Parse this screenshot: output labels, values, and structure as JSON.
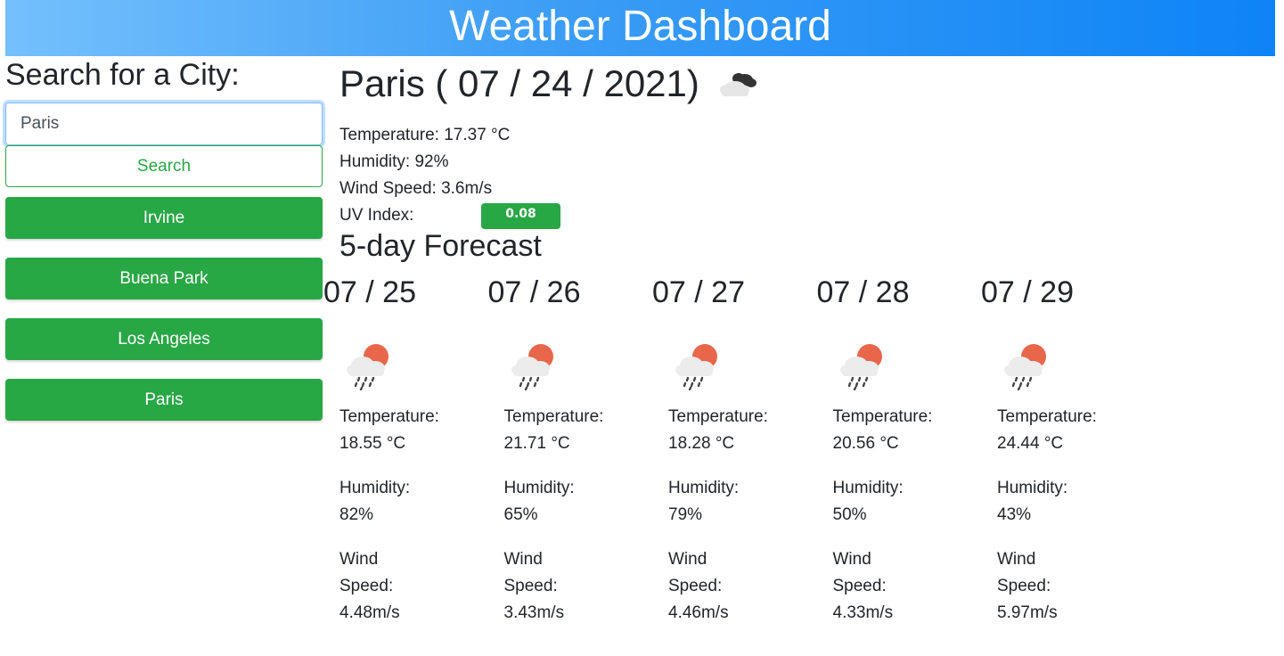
{
  "header": {
    "title": "Weather Dashboard"
  },
  "sidebar": {
    "heading": "Search for a City:",
    "search_value": "Paris",
    "search_button": "Search",
    "cities": [
      "Irvine",
      "Buena Park",
      "Los Angeles",
      "Paris"
    ]
  },
  "current": {
    "title": "Paris ( 07 / 24 / 2021)",
    "icon": "cloudy-icon",
    "temperature": "Temperature: 17.37 °C",
    "humidity": "Humidity: 92%",
    "wind": "Wind Speed: 3.6m/s",
    "uv_label": "UV Index:",
    "uv_value": "0.08",
    "uv_color": "#28a745"
  },
  "forecast": {
    "title": "5-day Forecast",
    "icon": "rain-sun-icon",
    "days": [
      {
        "date": "07 / 25",
        "temp_label": "Temperature:",
        "temp": "18.55 °C",
        "hum_label": "Humidity:",
        "hum": "82%",
        "wind_label1": "Wind",
        "wind_label2": "Speed:",
        "wind": "4.48m/s"
      },
      {
        "date": "07 / 26",
        "temp_label": "Temperature:",
        "temp": "21.71 °C",
        "hum_label": "Humidity:",
        "hum": "65%",
        "wind_label1": "Wind",
        "wind_label2": "Speed:",
        "wind": "3.43m/s"
      },
      {
        "date": "07 / 27",
        "temp_label": "Temperature:",
        "temp": "18.28 °C",
        "hum_label": "Humidity:",
        "hum": "79%",
        "wind_label1": "Wind",
        "wind_label2": "Speed:",
        "wind": "4.46m/s"
      },
      {
        "date": "07 / 28",
        "temp_label": "Temperature:",
        "temp": "20.56 °C",
        "hum_label": "Humidity:",
        "hum": "50%",
        "wind_label1": "Wind",
        "wind_label2": "Speed:",
        "wind": "4.33m/s"
      },
      {
        "date": "07 / 29",
        "temp_label": "Temperature:",
        "temp": "24.44 °C",
        "hum_label": "Humidity:",
        "hum": "43%",
        "wind_label1": "Wind",
        "wind_label2": "Speed:",
        "wind": "5.97m/s"
      }
    ]
  }
}
